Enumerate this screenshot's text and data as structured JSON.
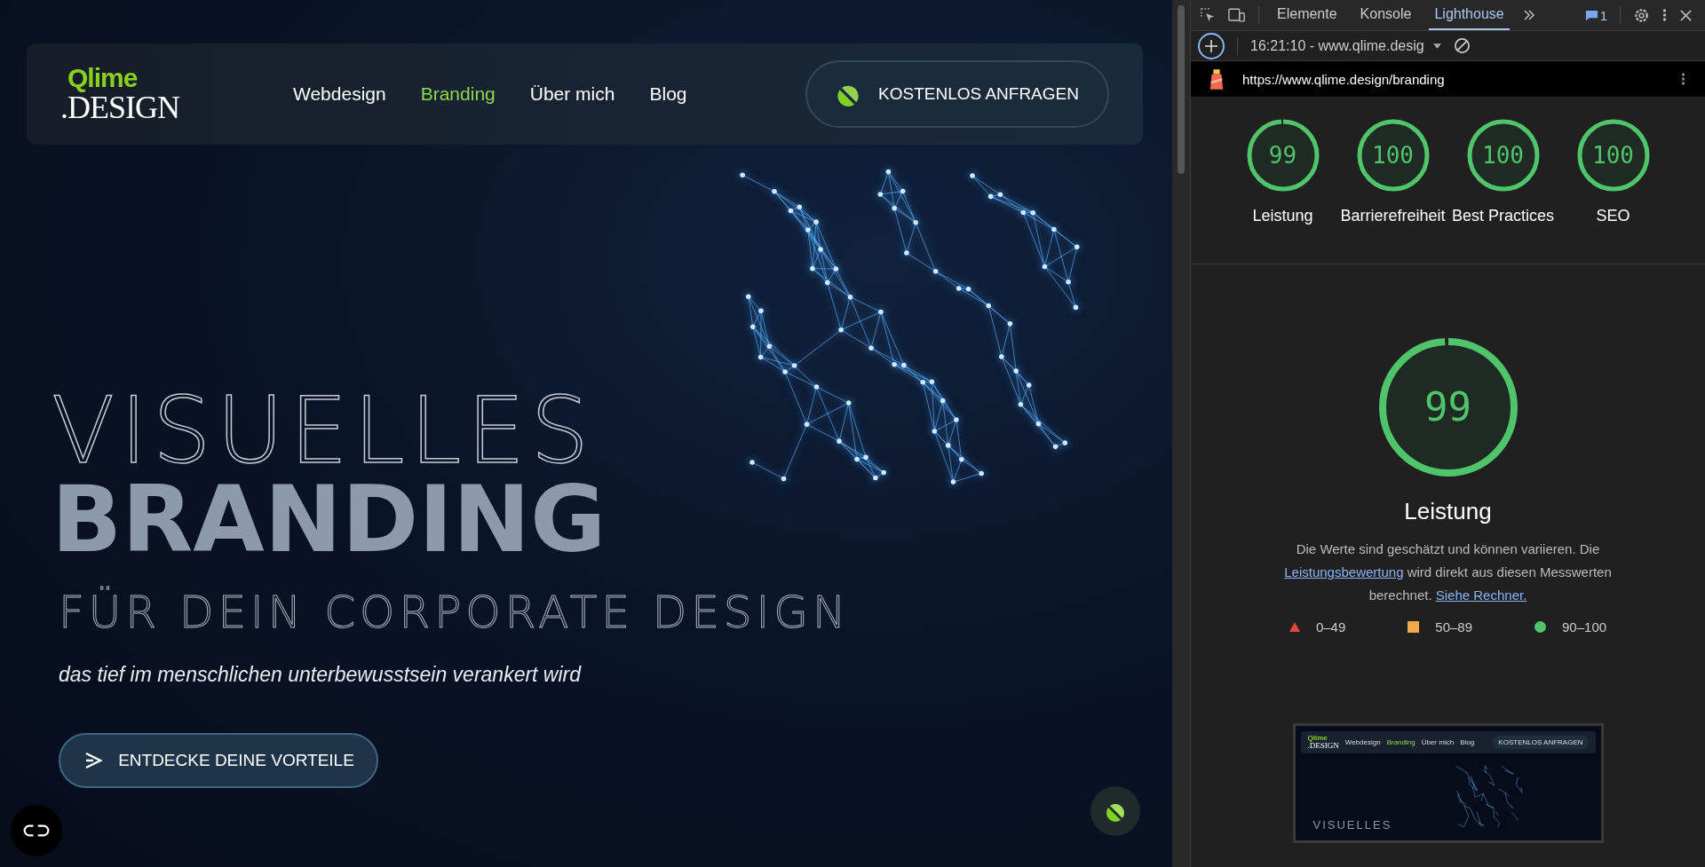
{
  "website": {
    "logo": {
      "top": "Qlime",
      "bottom": ".DESIGN"
    },
    "nav": [
      {
        "label": "Webdesign",
        "selected": false
      },
      {
        "label": "Branding",
        "selected": true
      },
      {
        "label": "Über mich",
        "selected": false
      },
      {
        "label": "Blog",
        "selected": false
      }
    ],
    "cta": "KOSTENLOS ANFRAGEN",
    "hero": {
      "line1": "VISUELLES",
      "line2": "BRANDING",
      "line3": "FÜR DEIN CORPORATE DESIGN",
      "tagline": "das tief im menschlichen unterbewusstsein verankert wird",
      "button": "ENTDECKE DEINE VORTEILE"
    }
  },
  "devtools": {
    "tabs": [
      {
        "label": "Elemente",
        "selected": false
      },
      {
        "label": "Konsole",
        "selected": false
      },
      {
        "label": "Lighthouse",
        "selected": true
      }
    ],
    "issues_count": "1",
    "report_select": "16:21:10 - www.qlime.desig",
    "url": "https://www.qlime.design/branding",
    "scores": [
      {
        "value": "99",
        "label": "Leistung",
        "level": 0.99
      },
      {
        "value": "100",
        "label": "Barrierefreiheit",
        "level": 1
      },
      {
        "value": "100",
        "label": "Best Practices",
        "level": 1
      },
      {
        "value": "100",
        "label": "SEO",
        "level": 1
      }
    ],
    "detail": {
      "value": "99",
      "level": 0.99,
      "title": "Leistung",
      "text_1": "Die Werte sind geschätzt und können variieren. Die",
      "link_1": "Leistungsbewertung",
      "text_2": "wird direkt aus diesen Messwerten berechnet.",
      "link_2": "Siehe Rechner."
    },
    "legend": [
      {
        "kind": "triangle",
        "color": "#e8483b",
        "label": "0–49"
      },
      {
        "kind": "square",
        "color": "#f3a94a",
        "label": "50–89"
      },
      {
        "kind": "circle",
        "color": "#4fc46a",
        "label": "90–100"
      }
    ],
    "thumbnail": {
      "logo_top": "Qlime",
      "logo_bottom": ".DESIGN",
      "nav": [
        {
          "label": "Webdesign",
          "selected": false
        },
        {
          "label": "Branding",
          "selected": true
        },
        {
          "label": "Über mich",
          "selected": false
        },
        {
          "label": "Blog",
          "selected": false
        }
      ],
      "cta": "KOSTENLOS ANFRAGEN",
      "headline": "VISUELLES"
    }
  }
}
